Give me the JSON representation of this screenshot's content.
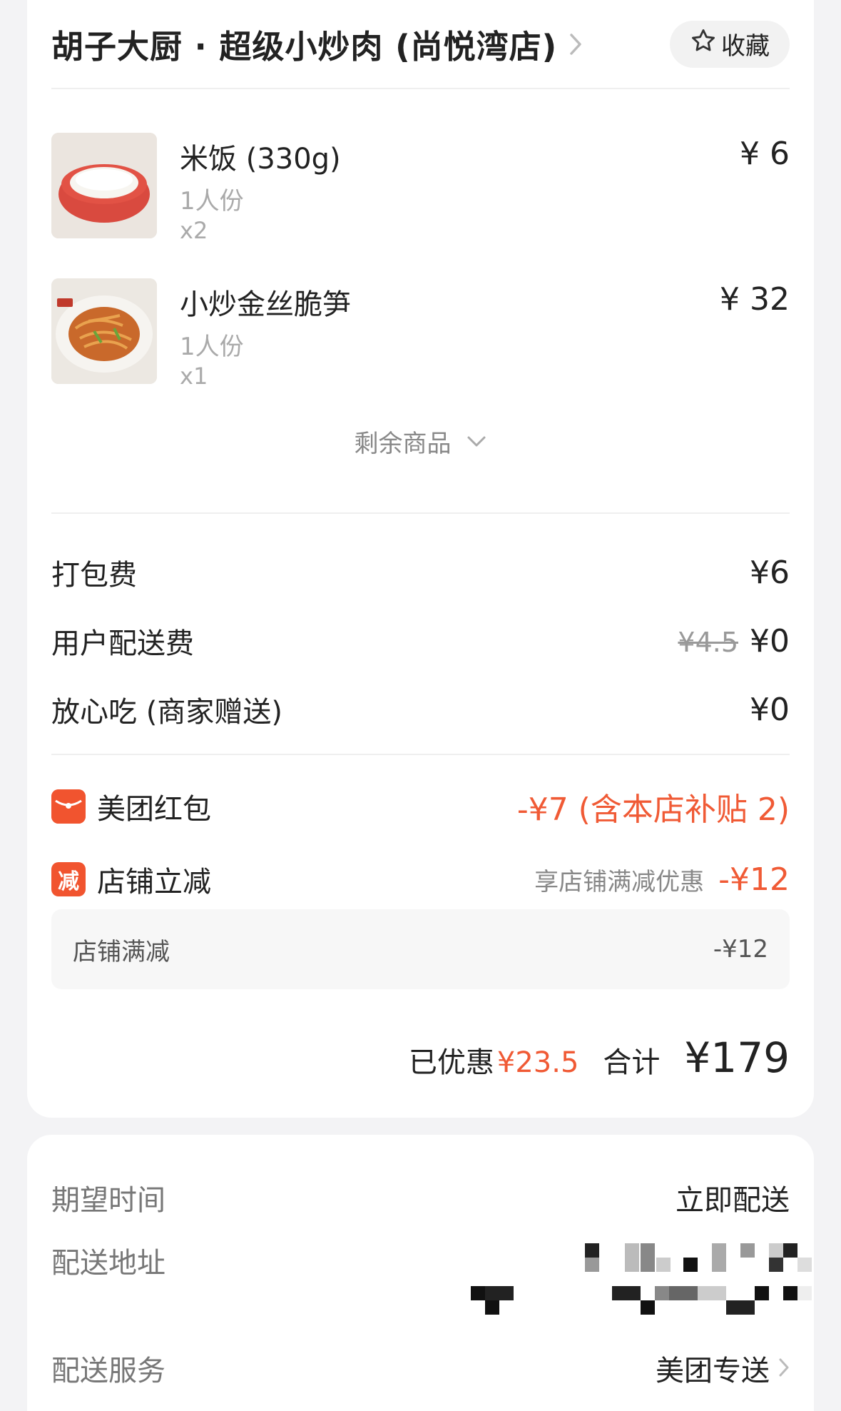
{
  "shop": {
    "name": "胡子大厨 · 超级小炒肉 (尚悦湾店)",
    "favorite_label": "收藏"
  },
  "items": [
    {
      "name": "米饭 (330g)",
      "spec": "1人份",
      "qty": "x2",
      "price": "¥ 6"
    },
    {
      "name": "小炒金丝脆笋",
      "spec": "1人份",
      "qty": "x1",
      "price": "¥ 32"
    }
  ],
  "more_items_label": "剩余商品",
  "fees": {
    "packing_label": "打包费",
    "packing_value": "¥6",
    "delivery_label": "用户配送费",
    "delivery_original": "¥4.5",
    "delivery_value": "¥0",
    "safe_label": "放心吃 (商家赠送)",
    "safe_value": "¥0"
  },
  "discounts": {
    "redpacket_label": "美团红包",
    "redpacket_value": "-¥7 (含本店补贴 2)",
    "shop_reduce_badge": "减",
    "shop_reduce_label": "店铺立减",
    "shop_reduce_note": "享店铺满减优惠",
    "shop_reduce_value": "-¥12",
    "sub_label": "店铺满减",
    "sub_value": "-¥12"
  },
  "totals": {
    "saved_label": "已优惠",
    "saved_value": "¥23.5",
    "total_label": "合计",
    "total_value": "¥179"
  },
  "delivery": {
    "time_label": "期望时间",
    "time_value": "立即配送",
    "address_label": "配送地址",
    "service_label": "配送服务",
    "service_value": "美团专送"
  },
  "colors": {
    "accent": "#f05a35",
    "badge": "#f1542f"
  }
}
